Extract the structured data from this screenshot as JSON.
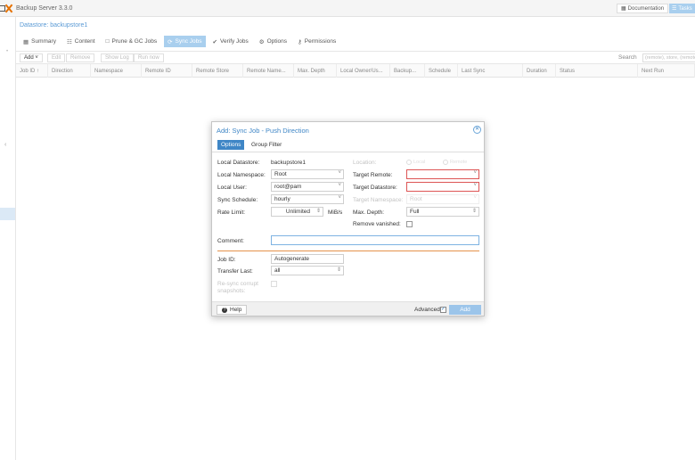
{
  "app": {
    "title": "Backup Server 3.3.0",
    "doc_label": "Documentation",
    "tasks_label": "Tasks"
  },
  "datastore": {
    "title": "Datastore: backupstore1"
  },
  "tabs": [
    {
      "label": "Summary",
      "icon": "book-icon"
    },
    {
      "label": "Content",
      "icon": "grid-icon"
    },
    {
      "label": "Prune & GC Jobs",
      "icon": "trash-icon"
    },
    {
      "label": "Sync Jobs",
      "icon": "sync-icon"
    },
    {
      "label": "Verify Jobs",
      "icon": "check-circle-icon"
    },
    {
      "label": "Options",
      "icon": "gear-icon"
    },
    {
      "label": "Permissions",
      "icon": "key-icon"
    }
  ],
  "toolbar": {
    "add": "Add",
    "edit": "Edit",
    "remove": "Remove",
    "show_log": "Show Log",
    "run_now": "Run now",
    "search_label": "Search",
    "search_placeholder": "(remote), store, (remote), id, ..."
  },
  "columns": [
    "Job ID",
    "Direction",
    "Namespace",
    "Remote ID",
    "Remote Store",
    "Remote Name...",
    "Max. Depth",
    "Local Owner/Us...",
    "Backup...",
    "Schedule",
    "Last Sync",
    "Duration",
    "Status",
    "Next Run"
  ],
  "dialog": {
    "title": "Add: Sync Job - Push Direction",
    "tab_options": "Options",
    "tab_group_filter": "Group Filter",
    "left": {
      "local_datastore_label": "Local Datastore:",
      "local_datastore_value": "backupstore1",
      "local_namespace_label": "Local Namespace:",
      "local_namespace_value": "Root",
      "local_user_label": "Local User:",
      "local_user_value": "root@pam",
      "sync_schedule_label": "Sync Schedule:",
      "sync_schedule_value": "hourly",
      "rate_limit_label": "Rate Limit:",
      "rate_limit_value": "Unlimited",
      "rate_limit_unit": "MiB/s"
    },
    "right": {
      "location_label": "Location:",
      "location_local": "Local",
      "location_remote": "Remote",
      "target_remote_label": "Target Remote:",
      "target_datastore_label": "Target Datastore:",
      "target_namespace_label": "Target Namespace:",
      "target_namespace_value": "Root",
      "max_depth_label": "Max. Depth:",
      "max_depth_value": "Full",
      "remove_vanished_label": "Remove vanished:"
    },
    "comment_label": "Comment:",
    "job_id_label": "Job ID:",
    "job_id_placeholder": "Autogenerate",
    "transfer_last_label": "Transfer Last:",
    "transfer_last_value": "all",
    "resync_label_1": "Re-sync corrupt",
    "resync_label_2": "snapshots:",
    "help": "Help",
    "advanced": "Advanced",
    "add": "Add"
  },
  "colors": {
    "accent": "#3f86c6",
    "tab_active": "#a9cfee",
    "error_border": "#d55555",
    "logo_orange": "#e57000"
  }
}
